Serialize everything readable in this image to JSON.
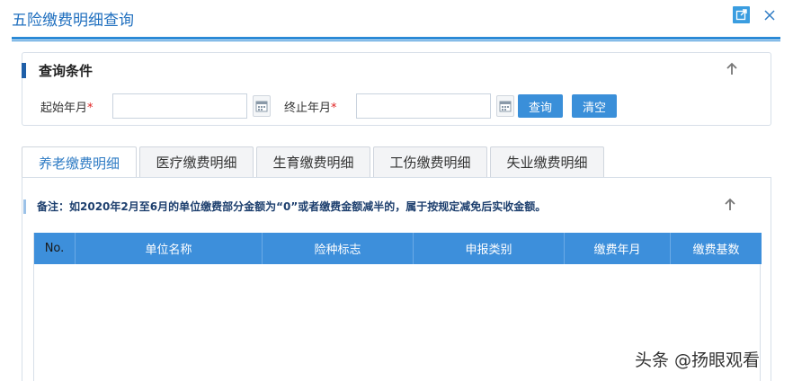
{
  "window": {
    "title": "五险缴费明细查询",
    "popout_icon": "external-link-icon",
    "close_icon": "close-icon"
  },
  "query": {
    "section_title": "查询条件",
    "collapse_icon": "arrow-up-icon",
    "start_label": "起始年月",
    "end_label": "终止年月",
    "required_mark": "*",
    "start_value": "",
    "end_value": "",
    "calendar_icon": "calendar-icon",
    "query_button": "查询",
    "clear_button": "清空"
  },
  "tabs": [
    {
      "label": "养老缴费明细",
      "active": true
    },
    {
      "label": "医疗缴费明细",
      "active": false
    },
    {
      "label": "生育缴费明细",
      "active": false
    },
    {
      "label": "工伤缴费明细",
      "active": false
    },
    {
      "label": "失业缴费明细",
      "active": false
    }
  ],
  "content": {
    "note": "备注：如2020年2月至6月的单位缴费部分金额为“0”或者缴费金额减半的，属于按规定减免后实收金额。",
    "collapse_icon": "arrow-up-icon",
    "columns": [
      "No.",
      "单位名称",
      "险种标志",
      "申报类别",
      "缴费年月",
      "缴费基数"
    ],
    "rows": []
  },
  "watermark": "头条 @扬眼观看",
  "colors": {
    "accent": "#3a8fd9",
    "title": "#1f6fbf",
    "header": "#3d8fdb",
    "required": "#e02020"
  }
}
